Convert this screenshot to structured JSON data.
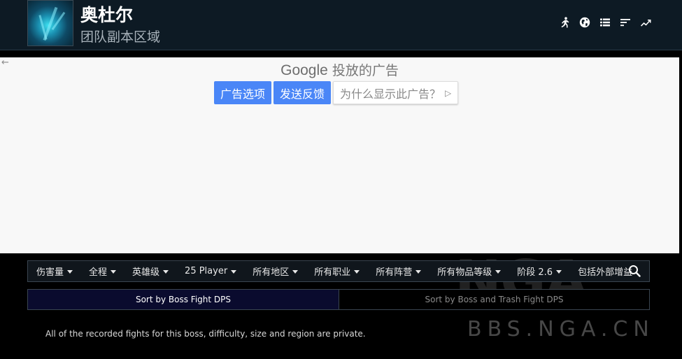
{
  "header": {
    "zone_name": "奥杜尔",
    "zone_type": "团队副本区域",
    "icons": [
      "runner-icon",
      "globe-icon",
      "list-icon",
      "sort-icon",
      "trend-icon"
    ]
  },
  "ad": {
    "back_arrow": "←",
    "brand": "Google",
    "brand_suffix": "投放的广告",
    "options_label": "广告选项",
    "feedback_label": "发送反馈",
    "why_label": "为什么显示此广告？",
    "why_icon": "▷"
  },
  "filters": [
    {
      "label": "伤害量"
    },
    {
      "label": "全程"
    },
    {
      "label": "英雄级"
    },
    {
      "label": "25 Player"
    },
    {
      "label": "所有地区"
    },
    {
      "label": "所有职业"
    },
    {
      "label": "所有阵营"
    },
    {
      "label": "所有物品等级"
    },
    {
      "label": "阶段 2.6"
    },
    {
      "label": "包括外部增益"
    }
  ],
  "sort": {
    "active": "Sort by Boss Fight DPS",
    "inactive": "Sort by Boss and Trash Fight DPS"
  },
  "message": "All of the recorded fights for this boss, difficulty, size and region are private.",
  "watermark": {
    "logo": "NGA",
    "text": "BBS.NGA.CN"
  },
  "colors": {
    "header_bg": "#0d1a24",
    "ad_button": "#4a86f7",
    "active_tab": "#0a0b2e"
  }
}
